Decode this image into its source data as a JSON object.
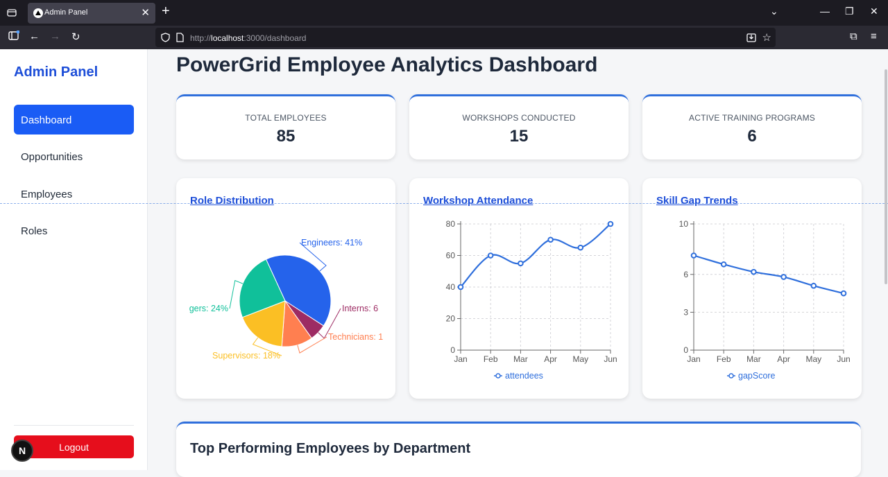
{
  "browser": {
    "tab_title": "Admin Panel",
    "url_prefix": "http://",
    "url_host": "localhost",
    "url_path": ":3000/dashboard"
  },
  "sidebar": {
    "brand": "Admin Panel",
    "items": [
      {
        "label": "Dashboard",
        "active": true
      },
      {
        "label": "Opportunities",
        "active": false
      },
      {
        "label": "Employees",
        "active": false
      },
      {
        "label": "Roles",
        "active": false
      }
    ],
    "logout_label": "Logout",
    "badge": "N"
  },
  "main": {
    "title": "PowerGrid Employee Analytics Dashboard",
    "stats": [
      {
        "label": "TOTAL EMPLOYEES",
        "value": "85"
      },
      {
        "label": "WORKSHOPS CONDUCTED",
        "value": "15"
      },
      {
        "label": "ACTIVE TRAINING PROGRAMS",
        "value": "6"
      }
    ],
    "bottom_title": "Top Performing Employees by Department"
  },
  "colors": {
    "accent": "#1a5cf5",
    "brand": "#1d4ed8",
    "logout": "#e60e1c",
    "line": "#2f6fdc"
  },
  "chart_data": [
    {
      "type": "pie",
      "title": "Role Distribution",
      "slices": [
        {
          "label": "Engineers: 41%",
          "value": 41,
          "color": "#2563eb"
        },
        {
          "label": "Interns: 6",
          "value": 6,
          "color": "#9d2b63"
        },
        {
          "label": "Technicians: 1",
          "value": 11,
          "color": "#ff7f50"
        },
        {
          "label": "Supervisors: 18%",
          "value": 18,
          "color": "#fbbf24"
        },
        {
          "label": "gers: 24%",
          "value": 24,
          "color": "#10c09a"
        }
      ]
    },
    {
      "type": "line",
      "title": "Workshop Attendance",
      "categories": [
        "Jan",
        "Feb",
        "Mar",
        "Apr",
        "May",
        "Jun"
      ],
      "series": [
        {
          "name": "attendees",
          "values": [
            40,
            60,
            55,
            70,
            65,
            80
          ]
        }
      ],
      "yticks": [
        "0",
        "20",
        "40",
        "60",
        "80"
      ],
      "ylim": [
        0,
        80
      ],
      "grid": true,
      "legend": "bottom"
    },
    {
      "type": "line",
      "title": "Skill Gap Trends",
      "categories": [
        "Jan",
        "Feb",
        "Mar",
        "Apr",
        "May",
        "Jun"
      ],
      "series": [
        {
          "name": "gapScore",
          "values": [
            7.5,
            6.8,
            6.2,
            5.8,
            5.1,
            4.5
          ]
        }
      ],
      "yticks": [
        "0",
        "3",
        "6",
        "10"
      ],
      "ytick_values": [
        0,
        3,
        6,
        10
      ],
      "ylim": [
        0,
        10
      ],
      "grid": true,
      "legend": "bottom"
    }
  ]
}
